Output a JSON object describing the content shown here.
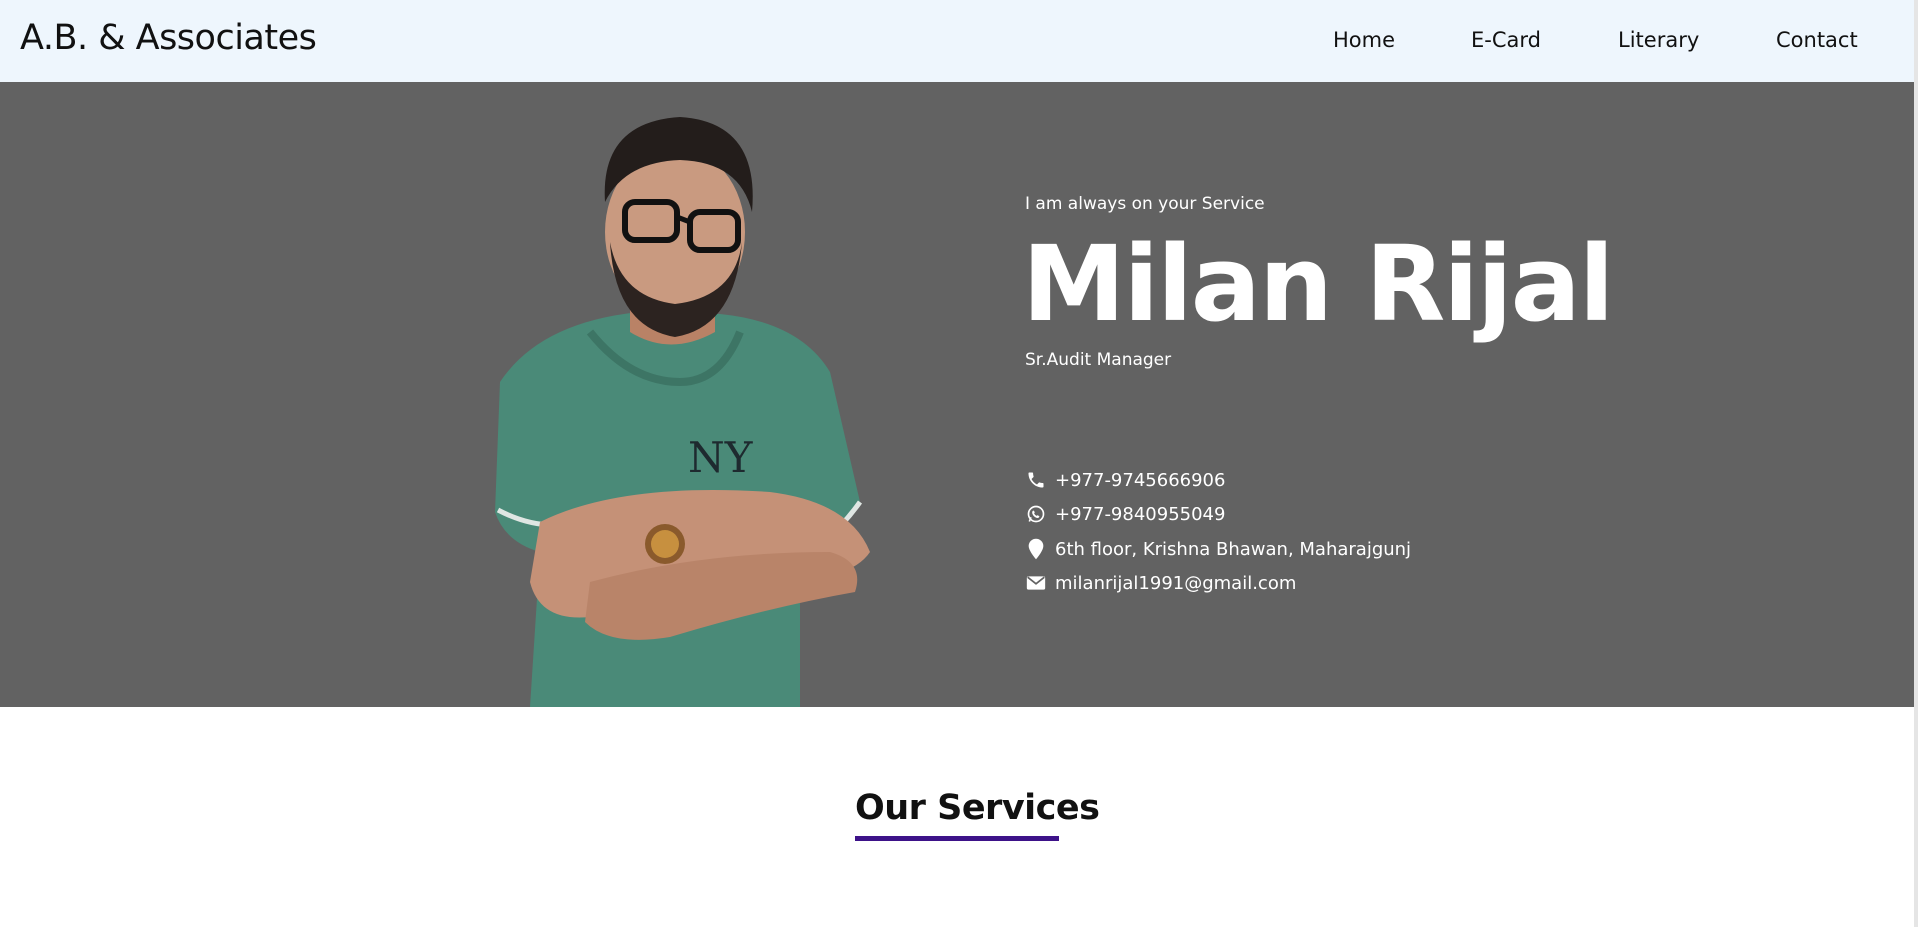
{
  "navbar": {
    "brand": "A.B. & Associates",
    "links": [
      {
        "label": "Home"
      },
      {
        "label": "E-Card"
      },
      {
        "label": "Literary"
      },
      {
        "label": "Contact"
      }
    ]
  },
  "hero": {
    "tagline": "I am always on your Service",
    "name": "Milan Rijal",
    "role": "Sr.Audit Manager",
    "contacts": {
      "phone": {
        "icon": "phone-icon",
        "text": "+977-9745666906"
      },
      "whatsapp": {
        "icon": "whatsapp-icon",
        "text": "+977-9840955049"
      },
      "address": {
        "icon": "map-pin-icon",
        "text": "6th floor, Krishna Bhawan, Maharajgunj"
      },
      "email": {
        "icon": "envelope-icon",
        "text": "milanrijal1991@gmail.com"
      }
    },
    "background_color": "#626262"
  },
  "services": {
    "title": "Our Services",
    "underline_color": "#3d1289"
  }
}
